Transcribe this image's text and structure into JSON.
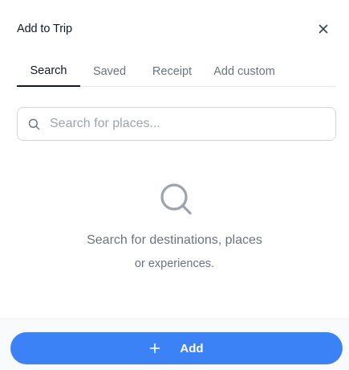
{
  "dialog": {
    "title": "Add to Trip",
    "close_icon": "close-icon"
  },
  "tabs": [
    {
      "label": "Search",
      "active": true
    },
    {
      "label": "Saved",
      "active": false
    },
    {
      "label": "Receipt",
      "active": false
    },
    {
      "label": "Add custom",
      "active": false
    }
  ],
  "search": {
    "placeholder": "Search for places...",
    "value": "",
    "icon": "search-icon"
  },
  "empty_state": {
    "icon": "search-icon",
    "line1": "Search for destinations, places",
    "line2": "or experiences."
  },
  "footer": {
    "add_label": "Add",
    "add_icon": "plus-icon"
  },
  "colors": {
    "accent": "#3b82f6",
    "text": "#111827",
    "muted": "#6b7280",
    "border": "#d1d5db"
  }
}
